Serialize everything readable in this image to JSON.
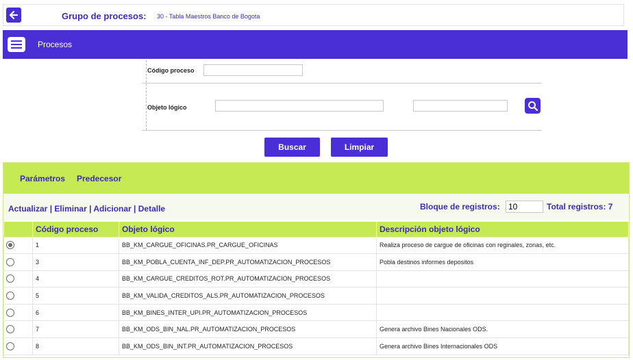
{
  "header": {
    "group_label": "Grupo de procesos:",
    "group_value": "30 - Tabla Maestros Banco de Bogota"
  },
  "section": {
    "title": "Procesos"
  },
  "form": {
    "codigo_label": "Código proceso",
    "codigo_value": "",
    "objeto_label": "Objeto lógico",
    "objeto_value_1": "",
    "objeto_value_2": "",
    "search_button": "Buscar",
    "clear_button": "Limpiar"
  },
  "tabs": [
    "Parámetros",
    "Predecesor"
  ],
  "actions": {
    "update": "Actualizar",
    "delete": "Eliminar",
    "add": "Adicionar",
    "detail": "Detalle",
    "separator": "|"
  },
  "pagination": {
    "block_label": "Bloque de registros:",
    "block_value": "10",
    "total_label": "Total registros: 7"
  },
  "table": {
    "columns": [
      "",
      "Código proceso",
      "Objeto lógico",
      "Descripción objeto lógico"
    ],
    "rows": [
      {
        "selected": true,
        "codigo": "1",
        "objeto": "BB_KM_CARGUE_OFICINAS.PR_CARGUE_OFICINAS",
        "descripcion": "Realiza proceso de cargue de oficinas con reginales, zonas, etc."
      },
      {
        "selected": false,
        "codigo": "3",
        "objeto": "BB_KM_POBLA_CUENTA_INF_DEP.PR_AUTOMATIZACION_PROCESOS",
        "descripcion": "Pobla destinos informes depositos"
      },
      {
        "selected": false,
        "codigo": "4",
        "objeto": "BB_KM_CARGUE_CREDITOS_ROT.PR_AUTOMATIZACION_PROCESOS",
        "descripcion": ""
      },
      {
        "selected": false,
        "codigo": "5",
        "objeto": "BB_KM_VALIDA_CREDITOS_ALS.PR_AUTOMATIZACION_PROCESOS",
        "descripcion": ""
      },
      {
        "selected": false,
        "codigo": "6",
        "objeto": "BB_KM_BINES_INTER_UPI.PR_AUTOMATIZACION_PROCESOS",
        "descripcion": ""
      },
      {
        "selected": false,
        "codigo": "7",
        "objeto": "BB_KM_ODS_BIN_NAL.PR_AUTOMATIZACION_PROCESOS",
        "descripcion": "Genera archivo Bines Nacionales ODS."
      },
      {
        "selected": false,
        "codigo": "8",
        "objeto": "BB_KM_ODS_BIN_INT.PR_AUTOMATIZACION_PROCESOS",
        "descripcion": "Genera archivo Bines Internacionales ODS"
      }
    ]
  },
  "colors": {
    "primary": "#4b2fd6",
    "accent": "#c6ea53",
    "link": "#3b2bb8"
  }
}
